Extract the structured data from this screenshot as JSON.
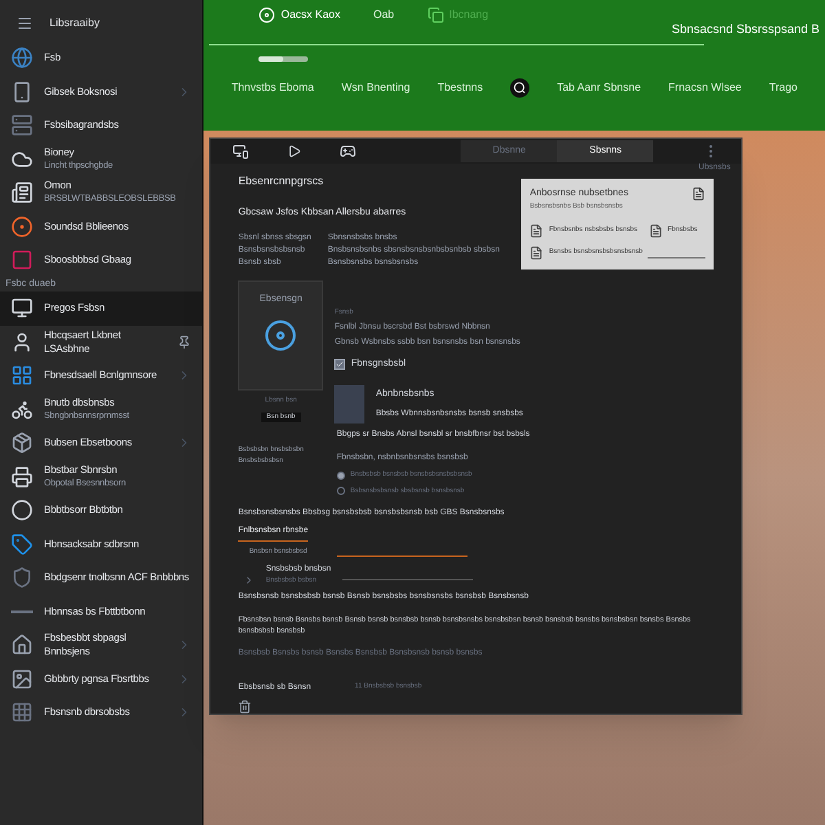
{
  "sidebar": {
    "title": "Libsraaiby",
    "items": [
      {
        "lines": [
          "Fsb"
        ],
        "kind": "plain",
        "selected": false
      },
      {
        "lines": [
          "Gibsek Boksnosi"
        ],
        "kind": "expandable",
        "selected": false
      },
      {
        "lines": [
          "Fsbsibagrandsbs"
        ],
        "kind": "plain",
        "selected": false
      },
      {
        "lines": [
          "Bioney",
          "Lincht thpschgbde"
        ],
        "kind": "plain",
        "selected": false
      },
      {
        "lines": [
          "Omon",
          "BRSBLWTBABBSLEOBSLEBBSB"
        ],
        "kind": "plain",
        "selected": false
      },
      {
        "lines": [
          "Soundsd Bblieenos"
        ],
        "kind": "plain",
        "selected": false
      },
      {
        "lines": [
          "Sboosbbbsd Gbaag"
        ],
        "kind": "plain",
        "selected": false
      },
      {
        "lines": [
          "Pregos Fsbsn"
        ],
        "kind": "plain",
        "selected": true,
        "caption": "Fsbc duaeb"
      },
      {
        "lines": [
          "Hbcqsaert Lkbnet LSAsbhne"
        ],
        "kind": "pinned",
        "selected": false
      },
      {
        "lines": [
          "Fbnesdsaell Bcnlgmnsore"
        ],
        "kind": "expandable",
        "selected": false
      },
      {
        "lines": [
          "Bnutb dbsbnsbs",
          "Sbngbnbsnnsrprnmsst"
        ],
        "kind": "plain",
        "selected": false
      },
      {
        "lines": [
          "Bubsen Ebsetboons"
        ],
        "kind": "expandable",
        "selected": false
      },
      {
        "lines": [
          "Bbstbar Sbnrsbn",
          "Obpotal Bsesnnbsorn"
        ],
        "kind": "plain",
        "selected": false
      },
      {
        "lines": [
          "Bbbtbsorr Bbtbtbn"
        ],
        "kind": "plain",
        "selected": false
      },
      {
        "lines": [
          "Hbnsacksabr sdbrsnn"
        ],
        "kind": "plain",
        "selected": false
      },
      {
        "lines": [
          "Bbdgsenr tnolbsnn ACF Bnbbbns"
        ],
        "kind": "plain",
        "selected": false
      },
      {
        "lines": [
          "Hbnnsas bs Fbttbtbonn"
        ],
        "kind": "plain",
        "selected": false
      },
      {
        "lines": [
          "Fbsbesbbt sbpagsl Bnnbsjens"
        ],
        "kind": "expandable",
        "selected": false
      },
      {
        "lines": [
          "Gbbbrty pgnsa Fbsrtbbs"
        ],
        "kind": "expandable",
        "selected": false
      },
      {
        "lines": [
          "Fbsnsnb dbrsobsbs"
        ],
        "kind": "expandable",
        "selected": false
      }
    ]
  },
  "header": {
    "brand": "Oacsx Kaox",
    "menu": "Oab",
    "dim_item": "Ibcnang",
    "title": "Sbnsacsnd Sbsrsspsand B",
    "slider": {
      "level": 0.5
    },
    "home": "Thnvstbs Eboma",
    "nav": [
      "Wsn Bnenting",
      "Tbestnns",
      "Tab Aanr Sbnsne",
      "Frnacsn Wlsee",
      "Trago"
    ]
  },
  "dialog": {
    "tabs": [
      {
        "label": "Dbsnne",
        "selected": false
      },
      {
        "label": "Sbsnns",
        "selected": true
      }
    ],
    "corner": "Ubsnsbs",
    "heading": "Ebsenrcnnpgrscs",
    "subheading": "Gbcsaw Jsfos Kbbsan Allersbu abarres",
    "col_left": [
      "Sbsnl sbnss sbsgsn",
      "Bsnsbsnsbsbsnsb",
      "Bsnsb sbsb"
    ],
    "col_right": [
      "Sbnsnsbsbs bnsbs",
      "Bnsbsnsbsnbs sbsnsbsnsbsnbsbsnbsb sbsbsn",
      "Bsnsbsnsbs bsnsbsnsbs"
    ],
    "card": {
      "title": "Anbosrnse nubsetbnes",
      "subtitle": "Bsbsnsbsnbs Bsb bsnsbsnsbs",
      "files": [
        "Fbnsbsnbs nsbsbsbs bsnsbs",
        "Fbnsbsbs"
      ],
      "field_label": "Bsnsbs bsnsbsnsbsbsnsbsnsb"
    },
    "cover": {
      "title": "Ebsensgn",
      "caption": "Lbsnn bsn",
      "side": "Bsn bsnb"
    },
    "detail": {
      "label": "Fsnsb",
      "lines": [
        "Fsnlbl Jbnsu bscrsbd Bst bsbrswd Nbbnsn",
        "Gbnsb Wsbnsbs ssbb bsn bsnsnsbs bsn bsnsnsbs"
      ],
      "check": {
        "label": "Fbnsgnsbsbl",
        "checked": true
      }
    },
    "media": {
      "title": "Abnbnsbsnbs",
      "text": "Bbsbs Wbnnsbsnbsnsbs bsnsb snsbsbs"
    },
    "side_note": [
      "Bsbsbsbn bnsbsbsbn",
      "Bnsbsbsbsbsn"
    ],
    "question": "Bbgps sr Bnsbs Abnsl bsnsbl sr bnsbfbnsr bst bsbsls",
    "options_title": "Fbnsbsbn, nsbnbsnbsnsbs bsnsbsb",
    "options": [
      {
        "label": "Bnsbsbsb bsnsbsb bsnsbsbsnsbsbsnsb",
        "selected": true
      },
      {
        "label": "Bsbsnsbsbsnsb sbsbsnsb bsnsbsnsb",
        "selected": false
      }
    ],
    "intro": "Bsnsbsnsbsnsbs Bbsbsg bsnsbsbsb bsnsbsbsnsb bsb GBS Bsnsbsnsbs",
    "section": "Fnlbsnsbsn rbnsbe",
    "field": {
      "label": "Bnsbsn bsnsbsbsd"
    },
    "entry": {
      "title": "Snsbsbsb bnsbsn",
      "subtitle": "Bnsbsbsb bsbsn"
    },
    "para1": "Bsnsbsnsb bsnsbsbsb bsnsb Bsnsb bsnsbsbs bsnsbsnsbs bsnsbsb Bsnsbsnsb",
    "para2": "Fbsnsbsn bsnsb Bsnsbs bsnsb Bsnsb bsnsb bsnsbsb bsnsb bsnsbsnsbs bsnsbsbsn bsnsb bsnsbsb bsnsbs bsnsbsbsn bsnsbs Bsnsbs bsnsbsbsb bsnsbsb",
    "para3": "Bsnsbsb Bsnsbs bsnsb Bsnsbs Bsnsbsb Bsnsbsnsb bsnsb bsnsbs",
    "footer_left": "Ebsbsnsb sb Bsnsn",
    "footer_right": "11 Bnsbsbsb bsnsbsb"
  }
}
